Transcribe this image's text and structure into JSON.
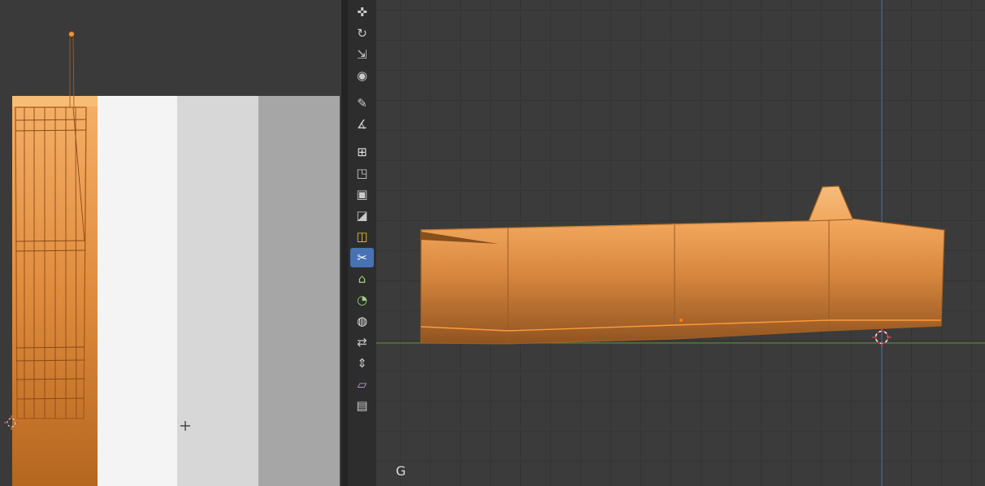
{
  "toolbar": {
    "items": [
      {
        "name": "move-tool",
        "glyph": "✜",
        "active": false
      },
      {
        "name": "rotate-tool",
        "glyph": "↻",
        "active": false
      },
      {
        "name": "scale-tool",
        "glyph": "⇲",
        "active": false
      },
      {
        "name": "transform-tool",
        "glyph": "◉",
        "active": false
      },
      {
        "name": "annotate-tool",
        "glyph": "✎",
        "active": false,
        "group_start": true
      },
      {
        "name": "measure-tool",
        "glyph": "∡",
        "active": false
      },
      {
        "name": "add-cube-tool",
        "glyph": "⊞",
        "active": false,
        "group_start": true,
        "tint": "#e2e2e2"
      },
      {
        "name": "extrude-region-tool",
        "glyph": "◳",
        "active": false
      },
      {
        "name": "inset-faces-tool",
        "glyph": "▣",
        "active": false
      },
      {
        "name": "bevel-tool",
        "glyph": "◪",
        "active": false
      },
      {
        "name": "loop-cut-tool",
        "glyph": "◫",
        "active": false,
        "tint": "#e8c23a"
      },
      {
        "name": "knife-tool",
        "glyph": "✂",
        "active": true
      },
      {
        "name": "poly-build-tool",
        "glyph": "⌂",
        "active": false,
        "tint": "#9fce7d"
      },
      {
        "name": "spin-tool",
        "glyph": "◔",
        "active": false,
        "tint": "#9fce7d"
      },
      {
        "name": "smooth-tool",
        "glyph": "◍",
        "active": false,
        "tint": "#e6e6e6"
      },
      {
        "name": "edge-slide-tool",
        "glyph": "⇄",
        "active": false
      },
      {
        "name": "shrink-fatten-tool",
        "glyph": "⇕",
        "active": false
      },
      {
        "name": "shear-tool",
        "glyph": "▱",
        "active": false,
        "tint": "#b9a3de"
      },
      {
        "name": "rip-region-tool",
        "glyph": "▤",
        "active": false
      }
    ],
    "active_tool_bg": "#4772b3"
  },
  "viewport": {
    "hud_text": "G",
    "background": "#3b3b3b",
    "grid_line_color": "#343434",
    "axis_vertical_color": "#44679c",
    "axis_horizontal_color": "#61803c"
  },
  "left_editor": {
    "background": "#3a3a3a",
    "band_colors": [
      "#f4f4f4",
      "#d7d7d7",
      "#a6a6a6"
    ],
    "selection_orange_top": "#f2a95f",
    "selection_orange_bottom": "#bc6e2c",
    "wire_color": "#8a4a15"
  },
  "mesh": {
    "fill_top": "#f6bc7c",
    "fill_bottom": "#8f5320",
    "wire_color": "#9a5a22",
    "selected_edge_color": "#ff9b3a",
    "cursor_ring_red": "#cc3333",
    "cursor_ring_white": "#eeeeee"
  }
}
